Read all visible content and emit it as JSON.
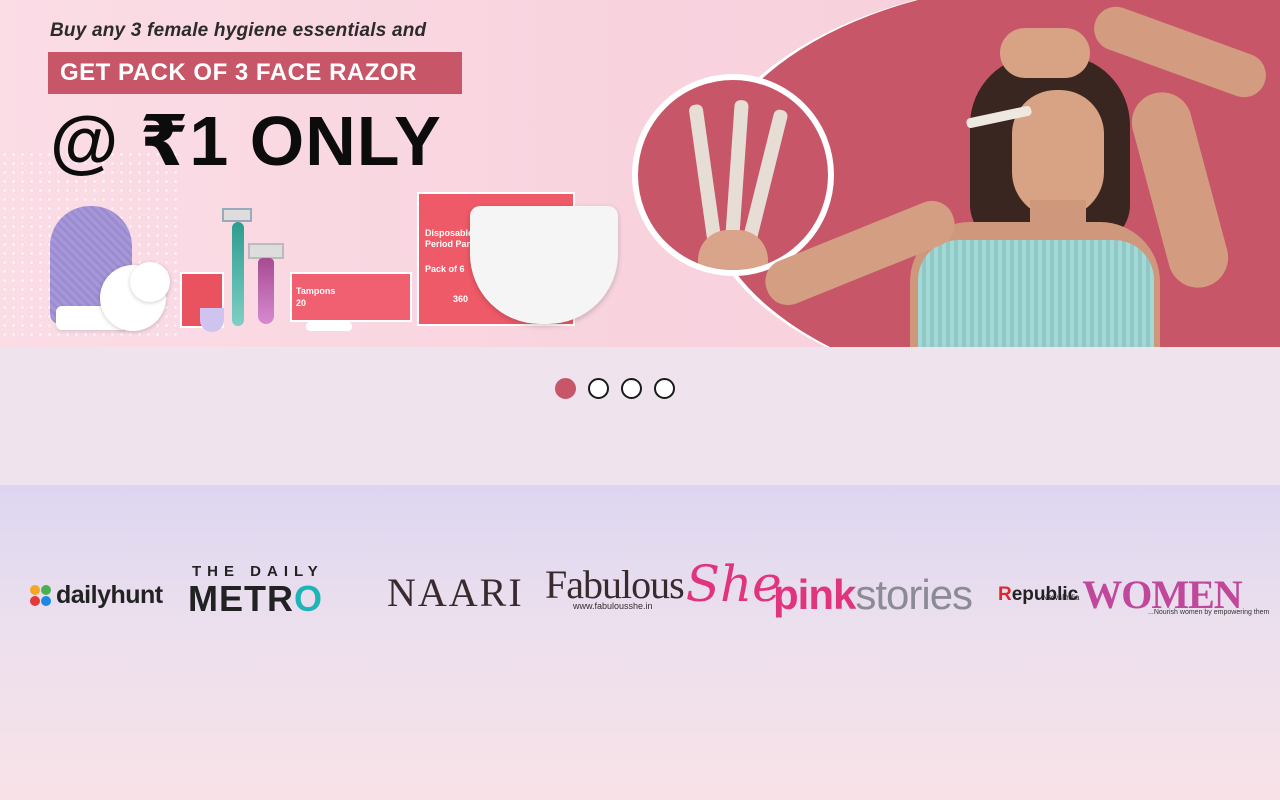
{
  "hero": {
    "line1": "Buy any 3 female hygiene essentials and",
    "line2": "GET PACK OF 3 FACE RAZOR",
    "line3": "@ ₹1 ONLY",
    "product_texts": {
      "tampons_box": "Tampons",
      "tampons_count": "20",
      "panty_box_title": "Disposable Period Panty",
      "panty_pack": "Pack of 6",
      "panty_count": "360"
    },
    "colors": {
      "accent": "#c85669",
      "background": "#f8d3de"
    }
  },
  "carousel": {
    "slides": [
      {
        "label": "Slide 1",
        "active": true
      },
      {
        "label": "Slide 2",
        "active": false
      },
      {
        "label": "Slide 3",
        "active": false
      },
      {
        "label": "Slide 4",
        "active": false
      }
    ]
  },
  "press": {
    "logos": [
      {
        "name": "dailyhunt",
        "text": "dailyhunt"
      },
      {
        "name": "the-daily-metro",
        "top": "THE DAILY",
        "main_a": "METR",
        "main_b": "O"
      },
      {
        "name": "naari",
        "text": "NAARI"
      },
      {
        "name": "fabulous-she",
        "text_a": "Fabulous",
        "text_b": "She",
        "url": "www.fabulousshe.in"
      },
      {
        "name": "pink-stories",
        "text_a": "pink",
        "text_b": "stories"
      },
      {
        "name": "republic-women",
        "rep_r": "R",
        "rep_rest": "epublic",
        "rep_sub": "NewsIndia",
        "women": "WOMEN",
        "tagline": "...Nourish women by empowering them"
      }
    ]
  }
}
